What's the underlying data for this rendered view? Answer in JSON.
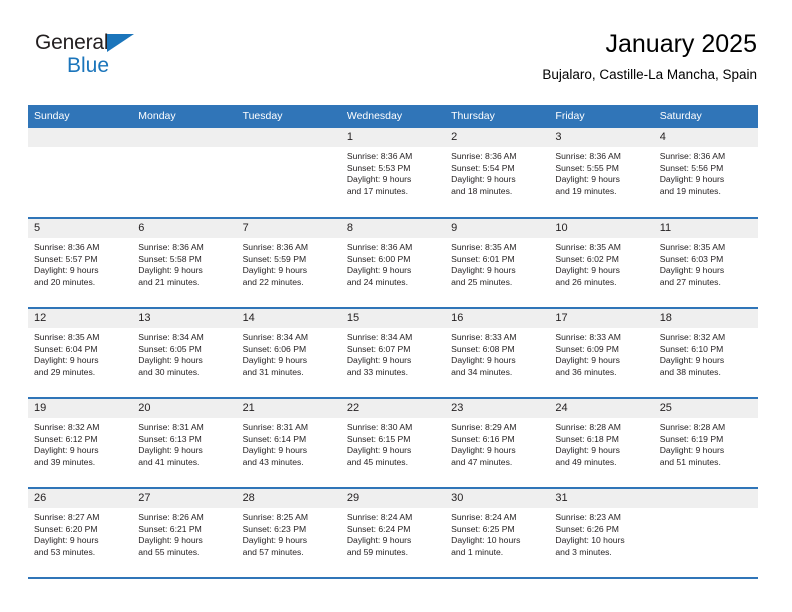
{
  "brand": {
    "line1": "General",
    "line2": "Blue",
    "accent_color": "#1b75bb"
  },
  "header": {
    "title": "January 2025",
    "subtitle": "Bujalaro, Castille-La Mancha, Spain"
  },
  "calendar": {
    "header_color": "#3075b8",
    "daynum_bg": "#efefef",
    "weekday_headers": [
      "Sunday",
      "Monday",
      "Tuesday",
      "Wednesday",
      "Thursday",
      "Friday",
      "Saturday"
    ],
    "weeks": [
      [
        {
          "day": "",
          "empty": true
        },
        {
          "day": "",
          "empty": true
        },
        {
          "day": "",
          "empty": true
        },
        {
          "day": "1",
          "sunrise": "Sunrise: 8:36 AM",
          "sunset": "Sunset: 5:53 PM",
          "daylight_1": "Daylight: 9 hours",
          "daylight_2": "and 17 minutes."
        },
        {
          "day": "2",
          "sunrise": "Sunrise: 8:36 AM",
          "sunset": "Sunset: 5:54 PM",
          "daylight_1": "Daylight: 9 hours",
          "daylight_2": "and 18 minutes."
        },
        {
          "day": "3",
          "sunrise": "Sunrise: 8:36 AM",
          "sunset": "Sunset: 5:55 PM",
          "daylight_1": "Daylight: 9 hours",
          "daylight_2": "and 19 minutes."
        },
        {
          "day": "4",
          "sunrise": "Sunrise: 8:36 AM",
          "sunset": "Sunset: 5:56 PM",
          "daylight_1": "Daylight: 9 hours",
          "daylight_2": "and 19 minutes."
        }
      ],
      [
        {
          "day": "5",
          "sunrise": "Sunrise: 8:36 AM",
          "sunset": "Sunset: 5:57 PM",
          "daylight_1": "Daylight: 9 hours",
          "daylight_2": "and 20 minutes."
        },
        {
          "day": "6",
          "sunrise": "Sunrise: 8:36 AM",
          "sunset": "Sunset: 5:58 PM",
          "daylight_1": "Daylight: 9 hours",
          "daylight_2": "and 21 minutes."
        },
        {
          "day": "7",
          "sunrise": "Sunrise: 8:36 AM",
          "sunset": "Sunset: 5:59 PM",
          "daylight_1": "Daylight: 9 hours",
          "daylight_2": "and 22 minutes."
        },
        {
          "day": "8",
          "sunrise": "Sunrise: 8:36 AM",
          "sunset": "Sunset: 6:00 PM",
          "daylight_1": "Daylight: 9 hours",
          "daylight_2": "and 24 minutes."
        },
        {
          "day": "9",
          "sunrise": "Sunrise: 8:35 AM",
          "sunset": "Sunset: 6:01 PM",
          "daylight_1": "Daylight: 9 hours",
          "daylight_2": "and 25 minutes."
        },
        {
          "day": "10",
          "sunrise": "Sunrise: 8:35 AM",
          "sunset": "Sunset: 6:02 PM",
          "daylight_1": "Daylight: 9 hours",
          "daylight_2": "and 26 minutes."
        },
        {
          "day": "11",
          "sunrise": "Sunrise: 8:35 AM",
          "sunset": "Sunset: 6:03 PM",
          "daylight_1": "Daylight: 9 hours",
          "daylight_2": "and 27 minutes."
        }
      ],
      [
        {
          "day": "12",
          "sunrise": "Sunrise: 8:35 AM",
          "sunset": "Sunset: 6:04 PM",
          "daylight_1": "Daylight: 9 hours",
          "daylight_2": "and 29 minutes."
        },
        {
          "day": "13",
          "sunrise": "Sunrise: 8:34 AM",
          "sunset": "Sunset: 6:05 PM",
          "daylight_1": "Daylight: 9 hours",
          "daylight_2": "and 30 minutes."
        },
        {
          "day": "14",
          "sunrise": "Sunrise: 8:34 AM",
          "sunset": "Sunset: 6:06 PM",
          "daylight_1": "Daylight: 9 hours",
          "daylight_2": "and 31 minutes."
        },
        {
          "day": "15",
          "sunrise": "Sunrise: 8:34 AM",
          "sunset": "Sunset: 6:07 PM",
          "daylight_1": "Daylight: 9 hours",
          "daylight_2": "and 33 minutes."
        },
        {
          "day": "16",
          "sunrise": "Sunrise: 8:33 AM",
          "sunset": "Sunset: 6:08 PM",
          "daylight_1": "Daylight: 9 hours",
          "daylight_2": "and 34 minutes."
        },
        {
          "day": "17",
          "sunrise": "Sunrise: 8:33 AM",
          "sunset": "Sunset: 6:09 PM",
          "daylight_1": "Daylight: 9 hours",
          "daylight_2": "and 36 minutes."
        },
        {
          "day": "18",
          "sunrise": "Sunrise: 8:32 AM",
          "sunset": "Sunset: 6:10 PM",
          "daylight_1": "Daylight: 9 hours",
          "daylight_2": "and 38 minutes."
        }
      ],
      [
        {
          "day": "19",
          "sunrise": "Sunrise: 8:32 AM",
          "sunset": "Sunset: 6:12 PM",
          "daylight_1": "Daylight: 9 hours",
          "daylight_2": "and 39 minutes."
        },
        {
          "day": "20",
          "sunrise": "Sunrise: 8:31 AM",
          "sunset": "Sunset: 6:13 PM",
          "daylight_1": "Daylight: 9 hours",
          "daylight_2": "and 41 minutes."
        },
        {
          "day": "21",
          "sunrise": "Sunrise: 8:31 AM",
          "sunset": "Sunset: 6:14 PM",
          "daylight_1": "Daylight: 9 hours",
          "daylight_2": "and 43 minutes."
        },
        {
          "day": "22",
          "sunrise": "Sunrise: 8:30 AM",
          "sunset": "Sunset: 6:15 PM",
          "daylight_1": "Daylight: 9 hours",
          "daylight_2": "and 45 minutes."
        },
        {
          "day": "23",
          "sunrise": "Sunrise: 8:29 AM",
          "sunset": "Sunset: 6:16 PM",
          "daylight_1": "Daylight: 9 hours",
          "daylight_2": "and 47 minutes."
        },
        {
          "day": "24",
          "sunrise": "Sunrise: 8:28 AM",
          "sunset": "Sunset: 6:18 PM",
          "daylight_1": "Daylight: 9 hours",
          "daylight_2": "and 49 minutes."
        },
        {
          "day": "25",
          "sunrise": "Sunrise: 8:28 AM",
          "sunset": "Sunset: 6:19 PM",
          "daylight_1": "Daylight: 9 hours",
          "daylight_2": "and 51 minutes."
        }
      ],
      [
        {
          "day": "26",
          "sunrise": "Sunrise: 8:27 AM",
          "sunset": "Sunset: 6:20 PM",
          "daylight_1": "Daylight: 9 hours",
          "daylight_2": "and 53 minutes."
        },
        {
          "day": "27",
          "sunrise": "Sunrise: 8:26 AM",
          "sunset": "Sunset: 6:21 PM",
          "daylight_1": "Daylight: 9 hours",
          "daylight_2": "and 55 minutes."
        },
        {
          "day": "28",
          "sunrise": "Sunrise: 8:25 AM",
          "sunset": "Sunset: 6:23 PM",
          "daylight_1": "Daylight: 9 hours",
          "daylight_2": "and 57 minutes."
        },
        {
          "day": "29",
          "sunrise": "Sunrise: 8:24 AM",
          "sunset": "Sunset: 6:24 PM",
          "daylight_1": "Daylight: 9 hours",
          "daylight_2": "and 59 minutes."
        },
        {
          "day": "30",
          "sunrise": "Sunrise: 8:24 AM",
          "sunset": "Sunset: 6:25 PM",
          "daylight_1": "Daylight: 10 hours",
          "daylight_2": "and 1 minute."
        },
        {
          "day": "31",
          "sunrise": "Sunrise: 8:23 AM",
          "sunset": "Sunset: 6:26 PM",
          "daylight_1": "Daylight: 10 hours",
          "daylight_2": "and 3 minutes."
        },
        {
          "day": "",
          "empty": true
        }
      ]
    ]
  }
}
